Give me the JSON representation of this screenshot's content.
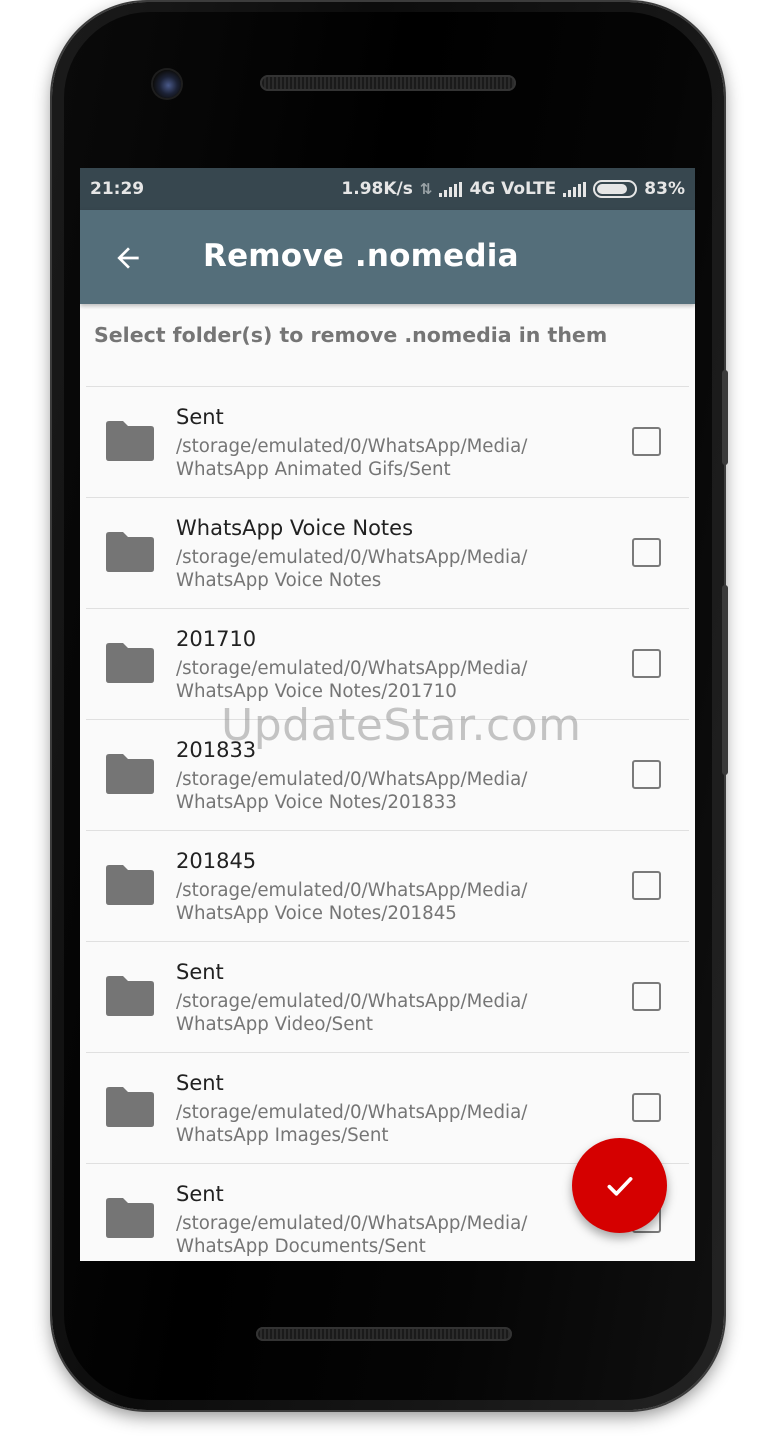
{
  "status_bar": {
    "time": "21:29",
    "speed": "1.98K/s",
    "network": "4G VoLTE",
    "battery": "83%",
    "battery_level": 0.83
  },
  "app_bar": {
    "title": "Remove .nomedia",
    "back_icon": "arrow-back-icon"
  },
  "subtitle": "Select folder(s) to remove .nomedia in them",
  "folders": [
    {
      "name": "Sent",
      "path_line1": "/storage/emulated/0/WhatsApp/Media/",
      "path_line2": "WhatsApp Animated Gifs/Sent",
      "checked": false
    },
    {
      "name": "WhatsApp Voice Notes",
      "path_line1": "/storage/emulated/0/WhatsApp/Media/",
      "path_line2": "WhatsApp Voice Notes",
      "checked": false
    },
    {
      "name": "201710",
      "path_line1": "/storage/emulated/0/WhatsApp/Media/",
      "path_line2": "WhatsApp Voice Notes/201710",
      "checked": false
    },
    {
      "name": "201833",
      "path_line1": "/storage/emulated/0/WhatsApp/Media/",
      "path_line2": "WhatsApp Voice Notes/201833",
      "checked": false
    },
    {
      "name": "201845",
      "path_line1": "/storage/emulated/0/WhatsApp/Media/",
      "path_line2": "WhatsApp Voice Notes/201845",
      "checked": false
    },
    {
      "name": "Sent",
      "path_line1": "/storage/emulated/0/WhatsApp/Media/",
      "path_line2": "WhatsApp Video/Sent",
      "checked": false
    },
    {
      "name": "Sent",
      "path_line1": "/storage/emulated/0/WhatsApp/Media/",
      "path_line2": "WhatsApp Images/Sent",
      "checked": false
    },
    {
      "name": "Sent",
      "path_line1": "/storage/emulated/0/WhatsApp/Media/",
      "path_line2": "WhatsApp Documents/Sent",
      "checked": false
    }
  ],
  "fab_icon": "check-icon",
  "watermark": "UpdateStar.com",
  "colors": {
    "status_bar": "#37474f",
    "app_bar": "#546e7a",
    "fab": "#d50000",
    "folder_icon": "#757575"
  }
}
